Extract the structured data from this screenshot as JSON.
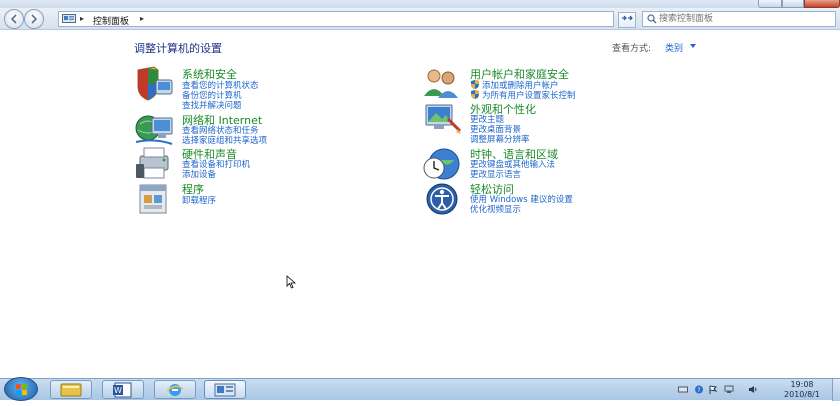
{
  "address": {
    "breadcrumb": "控制面板"
  },
  "search": {
    "placeholder": "搜索控制面板"
  },
  "main": {
    "title": "调整计算机的设置",
    "view_by_label": "查看方式:",
    "view_by_value": "类别"
  },
  "categories_left": [
    {
      "icon": "shield-flag-icon",
      "title": "系统和安全",
      "links": [
        "查看您的计算机状态",
        "备份您的计算机",
        "查找并解决问题"
      ]
    },
    {
      "icon": "network-globe-icon",
      "title": "网络和 Internet",
      "links": [
        "查看网络状态和任务",
        "选择家庭组和共享选项"
      ]
    },
    {
      "icon": "printer-icon",
      "title": "硬件和声音",
      "links": [
        "查看设备和打印机",
        "添加设备"
      ]
    },
    {
      "icon": "programs-icon",
      "title": "程序",
      "links": [
        "卸载程序"
      ]
    }
  ],
  "categories_right": [
    {
      "icon": "users-icon",
      "title": "用户帐户和家庭安全",
      "links": [
        "添加或删除用户帐户",
        "为所有用户设置家长控制"
      ]
    },
    {
      "icon": "appearance-icon",
      "title": "外观和个性化",
      "links": [
        "更改主题",
        "更改桌面背景",
        "调整屏幕分辨率"
      ]
    },
    {
      "icon": "clock-globe-icon",
      "title": "时钟、语言和区域",
      "links": [
        "更改键盘或其他输入法",
        "更改显示语言"
      ]
    },
    {
      "icon": "accessibility-icon",
      "title": "轻松访问",
      "links": [
        "使用 Windows 建议的设置",
        "优化视频显示"
      ]
    }
  ],
  "taskbar": {
    "clock_time": "19:08",
    "clock_date": "2010/8/1",
    "pinned": [
      "explorer-icon",
      "word-icon",
      "ie-icon",
      "control-panel-icon"
    ]
  },
  "colors": {
    "category_title": "#1a8a2a",
    "link": "#1e66cc",
    "page_title": "#1e3287"
  }
}
